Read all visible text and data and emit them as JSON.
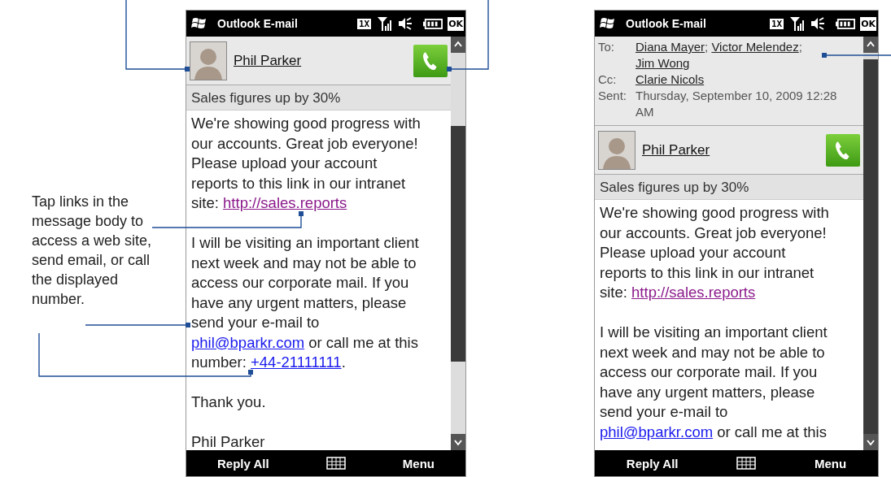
{
  "caption": "Tap links in the message body to access a web site, send email, or call the displayed number.",
  "screens": [
    {
      "title": "Outlook E-mail",
      "network_badge": "1X",
      "ok_button": "OK",
      "contact": {
        "name": "Phil Parker"
      },
      "subject": "Sales figures up by 30%",
      "body": [
        [
          {
            "kind": "text",
            "text": "We're showing good progress with our accounts. Great job everyone! Please upload your account reports to this link in our intranet site: "
          },
          {
            "kind": "url",
            "text": "http://sales.reports"
          }
        ],
        [
          {
            "kind": "text",
            "text": "I will be visiting an important client next week and may not be able to access our corporate mail. If you have any urgent matters, please send your e-mail to "
          },
          {
            "kind": "email",
            "text": "phil@bparkr.com"
          },
          {
            "kind": "text",
            "text": " or call me at this number: "
          },
          {
            "kind": "phone",
            "text": "+44-21111111"
          },
          {
            "kind": "text",
            "text": "."
          }
        ],
        [
          {
            "kind": "text",
            "text": "Thank you."
          }
        ],
        [
          {
            "kind": "text",
            "text": "Phil Parker"
          }
        ]
      ],
      "softkeys": {
        "left": "Reply All",
        "right": "Menu"
      }
    },
    {
      "title": "Outlook E-mail",
      "network_badge": "1X",
      "ok_button": "OK",
      "header_fields": [
        {
          "label": "To:",
          "recipients": [
            {
              "name": "Diana Mayer",
              "separator": ";"
            },
            {
              "name": "Victor Melendez",
              "separator": ";"
            },
            {
              "name": "Jim Wong"
            }
          ]
        },
        {
          "label": "Cc:",
          "recipients": [
            {
              "name": "Clarie Nicols"
            }
          ]
        },
        {
          "label": "Sent:",
          "value": "Thursday, September 10, 2009 12:28 AM"
        }
      ],
      "contact": {
        "name": "Phil Parker"
      },
      "subject": "Sales figures up by 30%",
      "body": [
        [
          {
            "kind": "text",
            "text": "We're showing good progress with our accounts. Great job everyone! Please upload your account reports to this link in our intranet site: "
          },
          {
            "kind": "url",
            "text": "http://sales.reports"
          }
        ],
        [
          {
            "kind": "text",
            "text": "I will be visiting an important client next week and may not be able to access our corporate mail. If you have any urgent matters, please send your e-mail to "
          },
          {
            "kind": "email",
            "text": "phil@bparkr.com"
          },
          {
            "kind": "text",
            "text": " or call me at this"
          }
        ]
      ],
      "softkeys": {
        "left": "Reply All",
        "right": "Menu"
      }
    }
  ]
}
